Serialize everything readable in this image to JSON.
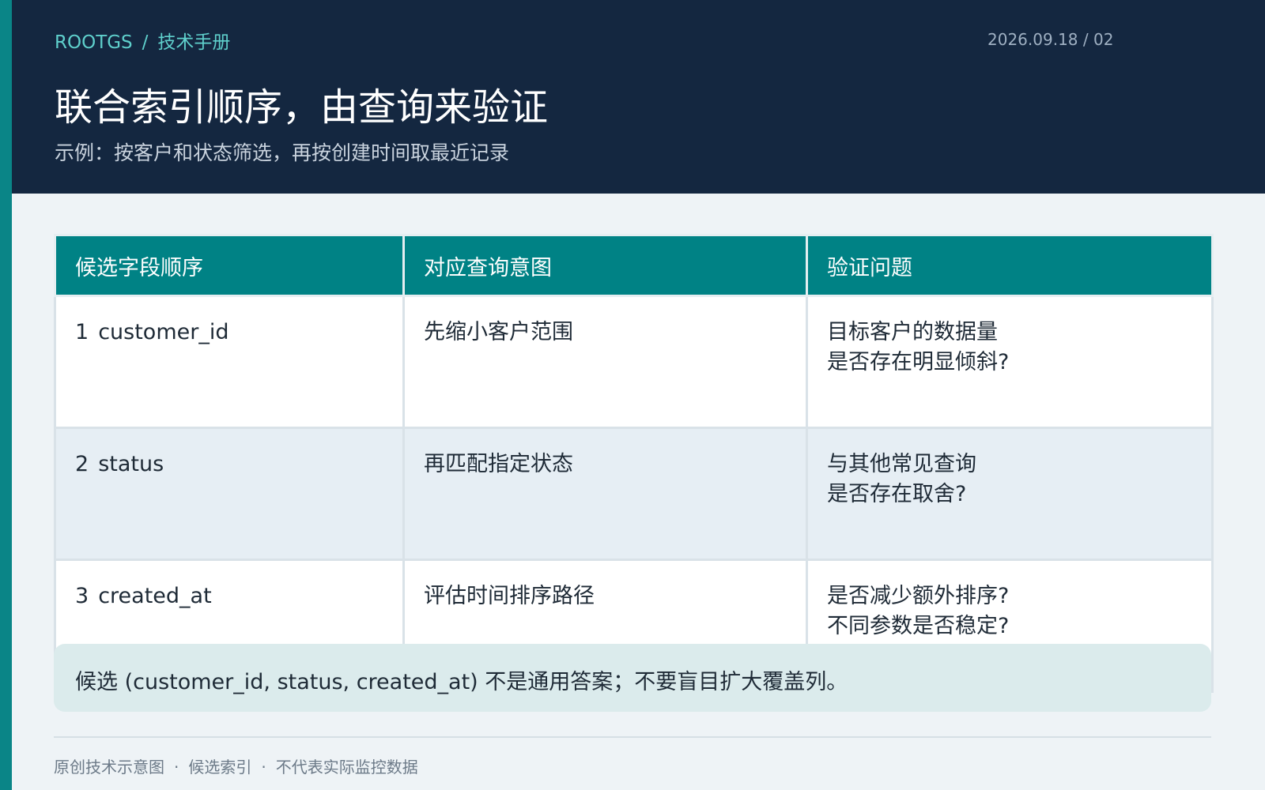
{
  "header": {
    "brand": "ROOTGS",
    "separator": "/",
    "section": "技术手册",
    "date": "2026.09.18 / 02",
    "title": "联合索引顺序，由查询来验证",
    "subtitle": "示例：按客户和状态筛选，再按创建时间取最近记录"
  },
  "table": {
    "headers": [
      "候选字段顺序",
      "对应查询意图",
      "验证问题"
    ],
    "rows": [
      {
        "index": "1",
        "field": "customer_id",
        "intent": "先缩小客户范围",
        "question_line1": "目标客户的数据量",
        "question_line2": "是否存在明显倾斜?"
      },
      {
        "index": "2",
        "field": "status",
        "intent": "再匹配指定状态",
        "question_line1": "与其他常见查询",
        "question_line2": "是否存在取舍?"
      },
      {
        "index": "3",
        "field": "created_at",
        "intent": "评估时间排序路径",
        "question_line1": "是否减少额外排序?",
        "question_line2": "不同参数是否稳定?"
      }
    ]
  },
  "note": "候选 (customer_id, status, created_at) 不是通用答案；不要盲目扩大覆盖列。",
  "footer": {
    "items": [
      "原创技术示意图",
      "候选索引",
      "不代表实际监控数据"
    ],
    "separator": "·"
  },
  "colors": {
    "header_bg": "#142740",
    "accent": "#0a8587",
    "table_header_bg": "#008285",
    "note_bg": "#dbebec"
  }
}
